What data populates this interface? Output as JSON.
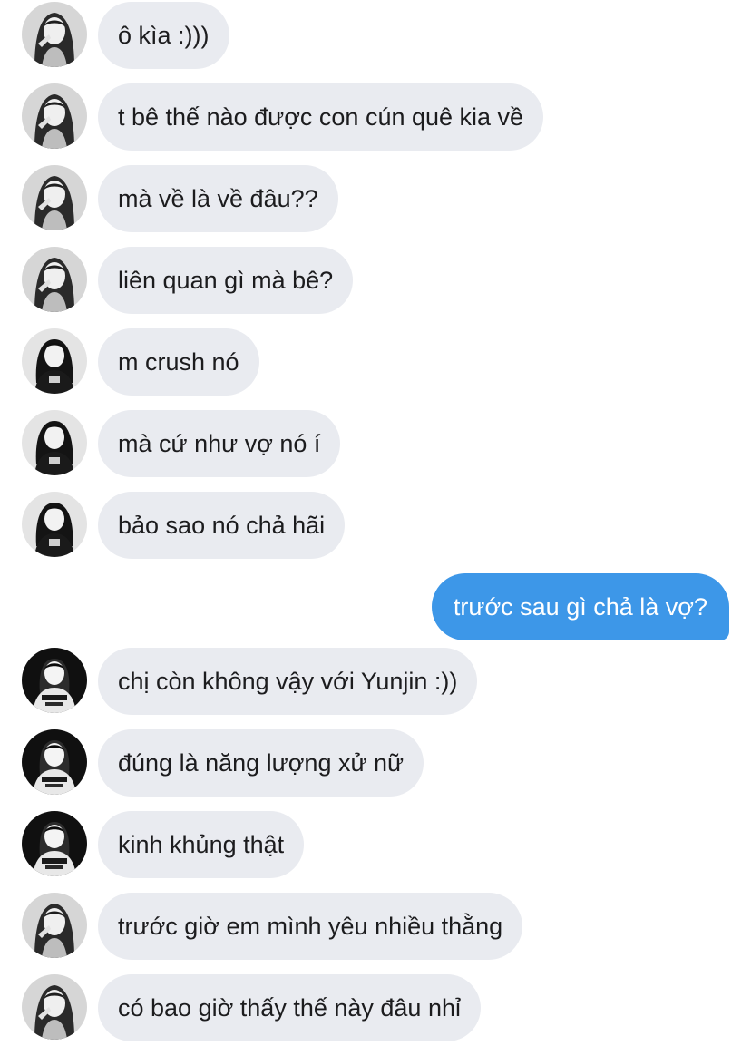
{
  "messages": [
    {
      "side": "in",
      "avatar": "contact-avatar-a",
      "text": "ô kìa :)))"
    },
    {
      "side": "in",
      "avatar": "contact-avatar-a",
      "text": "t bê thế nào được con cún quê kia về"
    },
    {
      "side": "in",
      "avatar": "contact-avatar-a",
      "text": "mà về là về đâu??"
    },
    {
      "side": "in",
      "avatar": "contact-avatar-a",
      "text": "liên quan gì mà bê?"
    },
    {
      "side": "in",
      "avatar": "contact-avatar-b",
      "text": "m crush nó"
    },
    {
      "side": "in",
      "avatar": "contact-avatar-b",
      "text": "mà cứ như vợ nó í"
    },
    {
      "side": "in",
      "avatar": "contact-avatar-b",
      "text": "bảo sao nó chả hãi"
    },
    {
      "side": "out",
      "avatar": "",
      "text": "trước sau gì chả là vợ?"
    },
    {
      "side": "in",
      "avatar": "contact-avatar-c",
      "text": "chị còn không vậy với Yunjin :))"
    },
    {
      "side": "in",
      "avatar": "contact-avatar-c",
      "text": "đúng là năng lượng xử nữ"
    },
    {
      "side": "in",
      "avatar": "contact-avatar-c",
      "text": "kinh khủng thật"
    },
    {
      "side": "in",
      "avatar": "contact-avatar-a",
      "text": "trước giờ em mình yêu nhiều thằng"
    },
    {
      "side": "in",
      "avatar": "contact-avatar-a",
      "text": "có bao giờ thấy thế này đâu nhỉ"
    }
  ],
  "colors": {
    "incoming_bubble": "#e9ebf0",
    "outgoing_bubble": "#3d97e8",
    "incoming_text": "#1c1c1e",
    "outgoing_text": "#ffffff"
  }
}
